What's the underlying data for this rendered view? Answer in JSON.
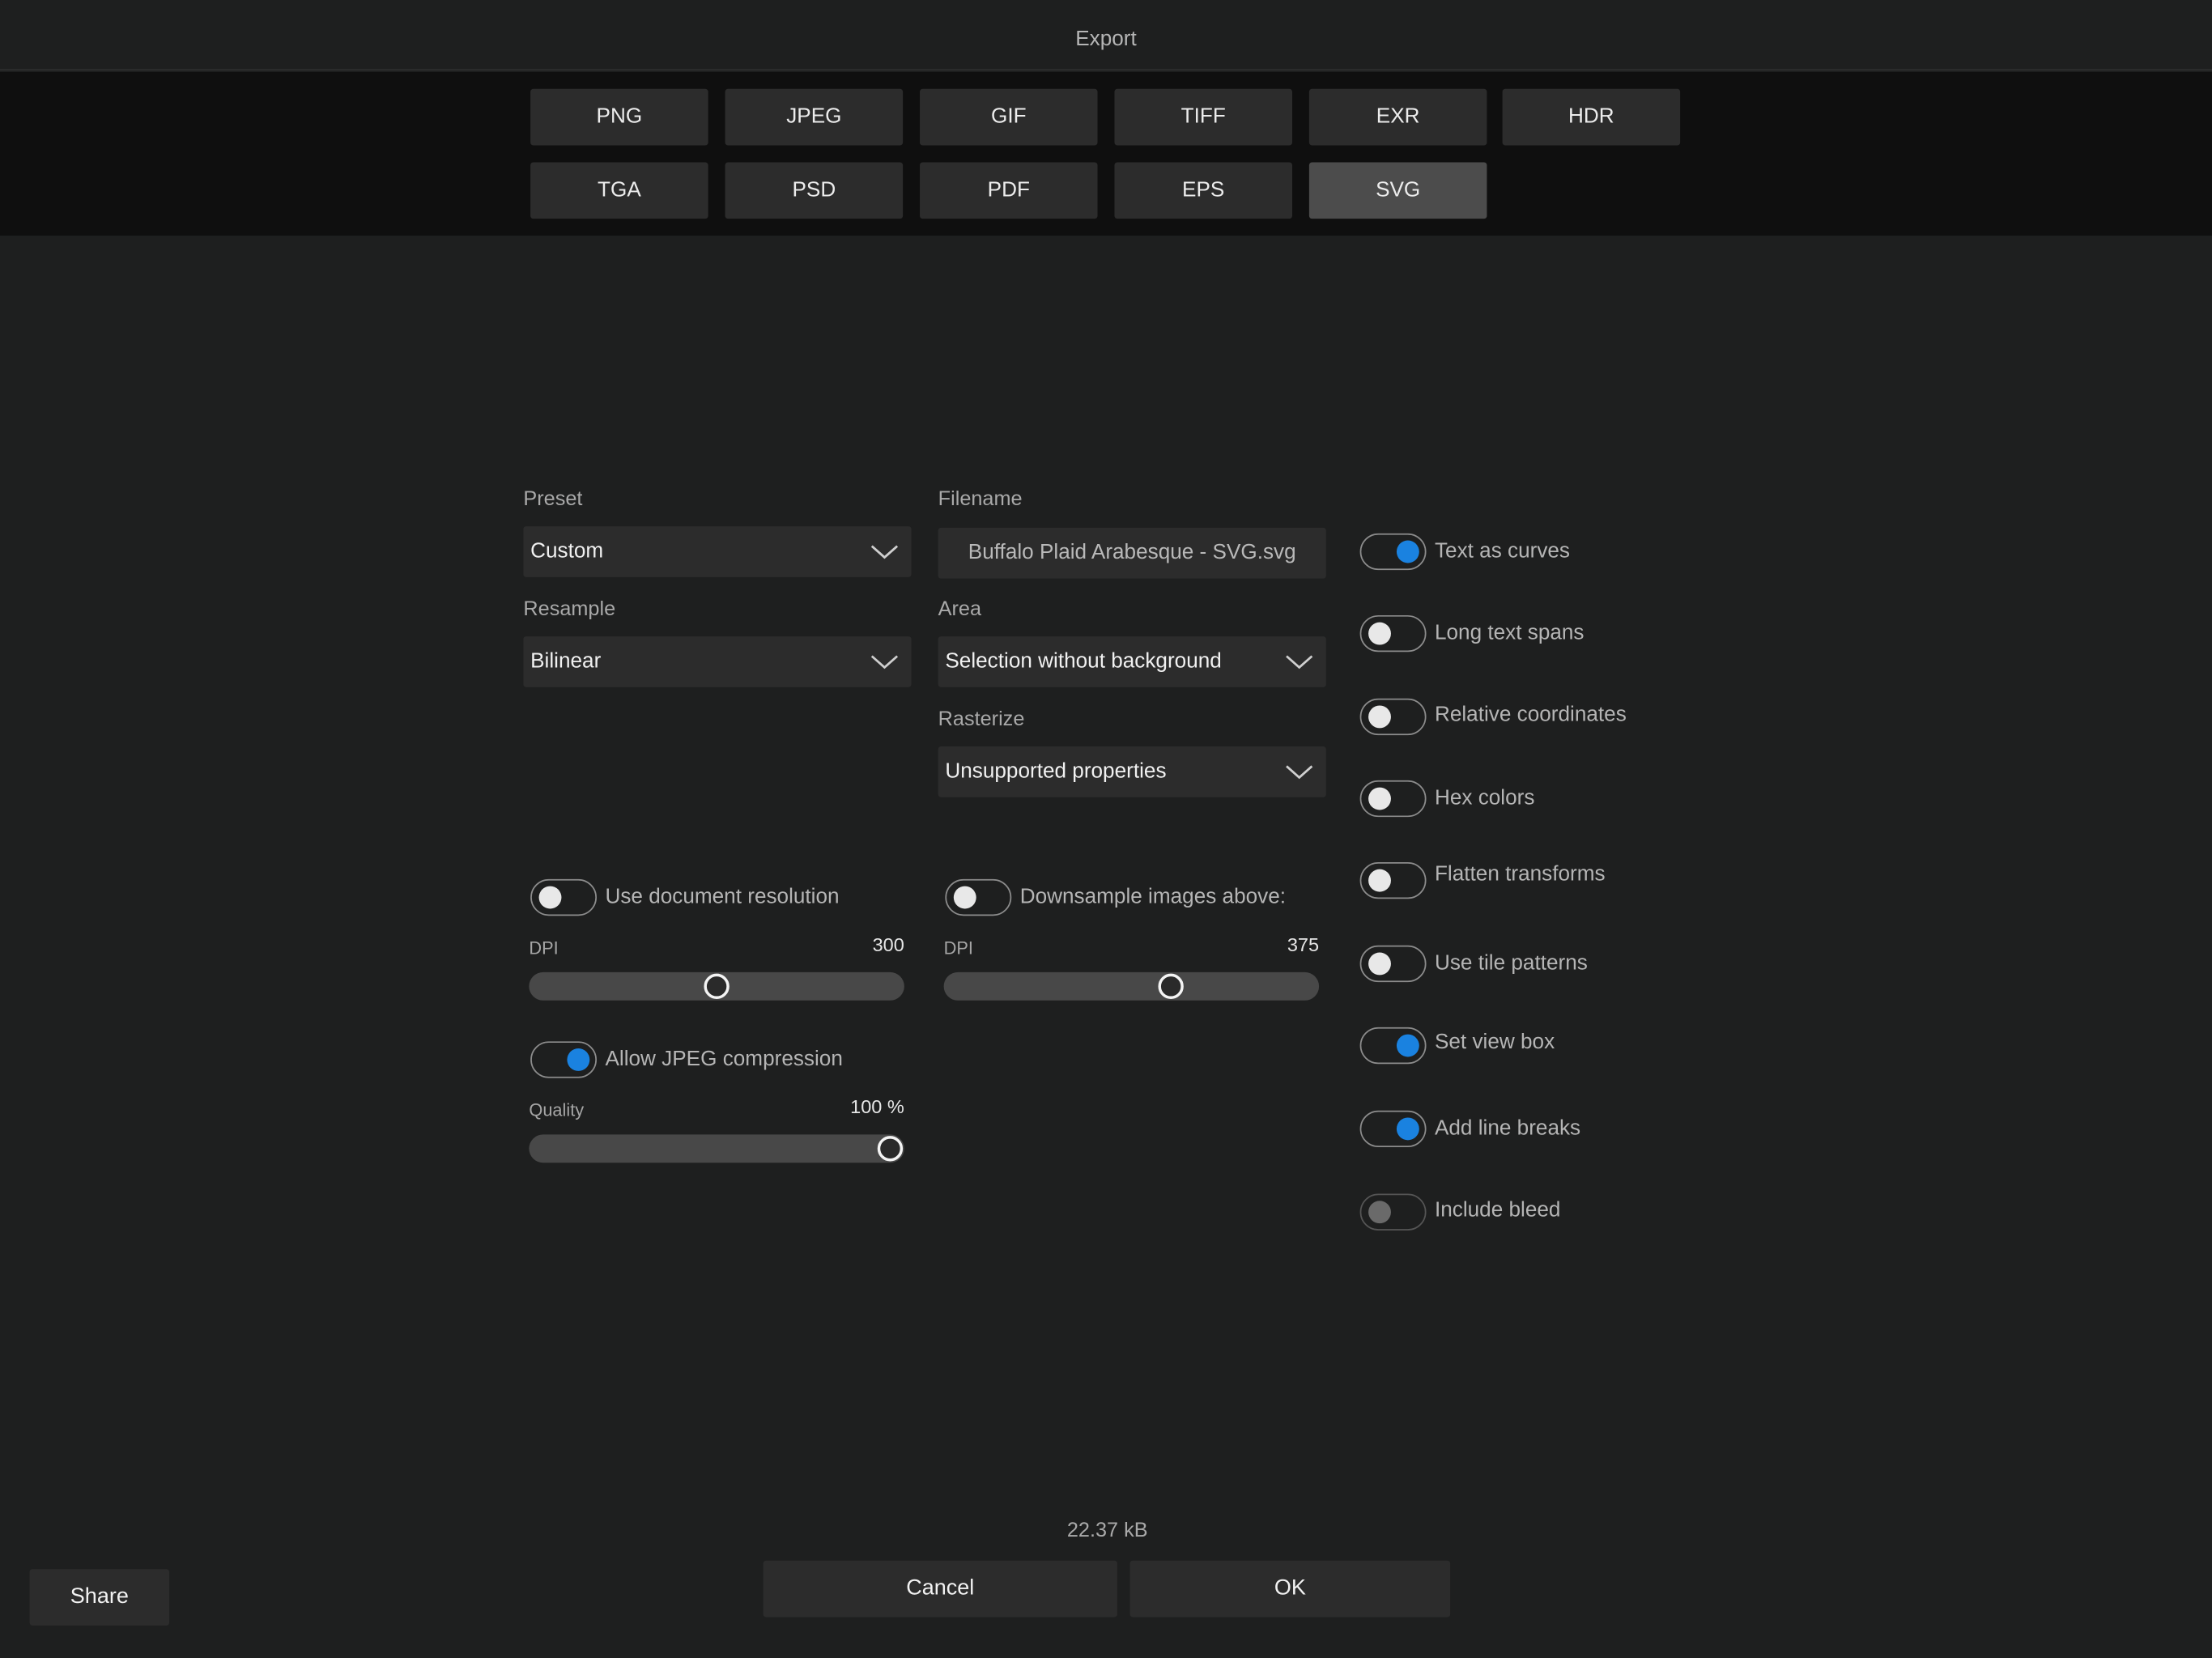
{
  "window": {
    "title": "Export"
  },
  "formats": {
    "row1": [
      {
        "label": "PNG"
      },
      {
        "label": "JPEG"
      },
      {
        "label": "GIF"
      },
      {
        "label": "TIFF"
      },
      {
        "label": "EXR"
      },
      {
        "label": "HDR"
      }
    ],
    "row2": [
      {
        "label": "TGA"
      },
      {
        "label": "PSD"
      },
      {
        "label": "PDF"
      },
      {
        "label": "EPS"
      },
      {
        "label": "SVG",
        "selected": true
      }
    ]
  },
  "settings": {
    "preset": {
      "label": "Preset",
      "value": "Custom"
    },
    "filename": {
      "label": "Filename",
      "value": "Buffalo Plaid Arabesque - SVG.svg"
    },
    "resample": {
      "label": "Resample",
      "value": "Bilinear"
    },
    "area": {
      "label": "Area",
      "value": "Selection without background"
    },
    "rasterize": {
      "label": "Rasterize",
      "value": "Unsupported properties"
    }
  },
  "resolution": {
    "use_doc_resolution": {
      "label": "Use document resolution",
      "on": false
    },
    "dpi_label": "DPI",
    "dpi_value": "300",
    "dpi_fraction": 0.5
  },
  "compression": {
    "allow_jpeg": {
      "label": "Allow JPEG compression",
      "on": true
    },
    "quality_label": "Quality",
    "quality_value": "100 %",
    "quality_fraction": 1.0
  },
  "downsample": {
    "toggle": {
      "label": "Downsample images above:",
      "on": false
    },
    "dpi_label": "DPI",
    "dpi_value": "375",
    "dpi_fraction": 0.615
  },
  "options": [
    {
      "label": "Text as curves",
      "on": true
    },
    {
      "label": "Long text spans",
      "on": false
    },
    {
      "label": "Relative coordinates",
      "on": false
    },
    {
      "label": "Hex colors",
      "on": false
    },
    {
      "label": "Flatten transforms",
      "on": false
    },
    {
      "label": "Use tile patterns",
      "on": false
    },
    {
      "label": "Set view box",
      "on": true
    },
    {
      "label": "Add line breaks",
      "on": true
    },
    {
      "label": "Include bleed",
      "on": false,
      "disabled": true
    }
  ],
  "footer": {
    "file_size": "22.37 kB",
    "share_label": "Share",
    "cancel_label": "Cancel",
    "ok_label": "OK"
  },
  "colors": {
    "accent": "#1a82e0",
    "background": "#1e1f1f",
    "button": "#2c2c2c",
    "selected_button": "#4c4c4c"
  },
  "icons": {
    "dropdown": "chevron-down-icon"
  }
}
